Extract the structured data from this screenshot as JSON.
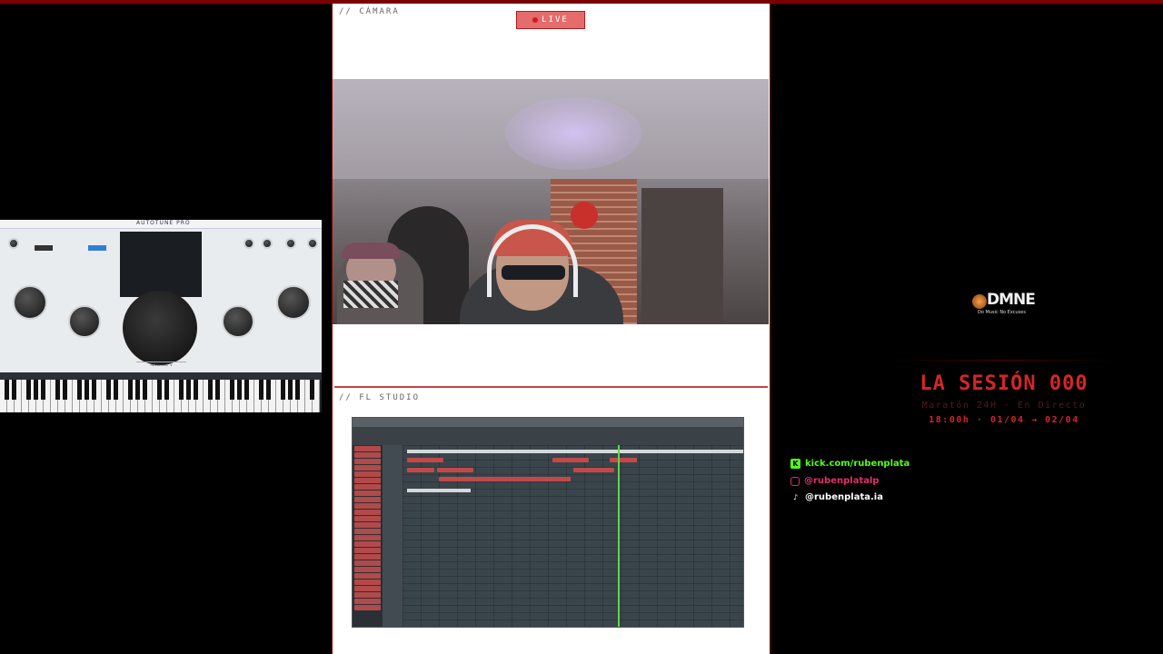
{
  "camera_section": {
    "label": "// CÁMARA",
    "live_label": "LIVE"
  },
  "fl_section": {
    "label": "// FL STUDIO"
  },
  "autotune": {
    "title": "AUTOTUNE PRO",
    "advanced_label": "Advanced ∨"
  },
  "brand": {
    "logo_text": "DMNE",
    "tagline": "Do Music No Excuses"
  },
  "event": {
    "title": "LA SESIÓN 000",
    "subtitle": "Maratón 24H · En Directo",
    "dates": "18:00h · 01/04 → 02/04"
  },
  "socials": [
    {
      "icon": "kick-icon",
      "text": "kick.com/rubenplata",
      "color": "#53fc18"
    },
    {
      "icon": "instagram-icon",
      "text": "@rubenplatalp",
      "color": "#e1306c"
    },
    {
      "icon": "tiktok-icon",
      "text": "@rubenplata.ia",
      "color": "#ffffff"
    }
  ],
  "colors": {
    "accent": "#d42626",
    "panel": "#ffffff",
    "background": "#000000"
  }
}
